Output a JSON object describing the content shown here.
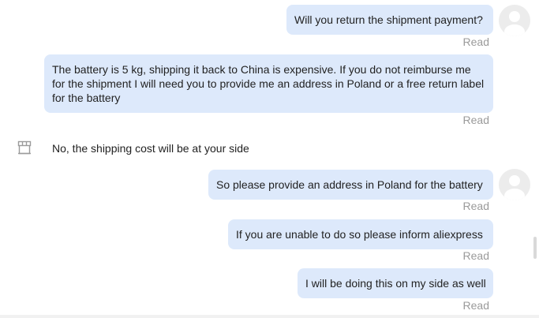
{
  "messages": [
    {
      "text": "Will you return the shipment payment?",
      "status": "Read"
    },
    {
      "text": "The battery is 5 kg, shipping it back to China is expensive. If you do not reimburse me for the shipment I will need you to provide me an address in Poland or a free return label for the battery",
      "status": "Read"
    },
    {
      "text": "No, the shipping cost will be at your side"
    },
    {
      "text": "So please provide an address in Poland for the battery",
      "status": "Read"
    },
    {
      "text": "If you are unable to do so please inform aliexpress",
      "status": "Read"
    },
    {
      "text": "I will be doing this on my side as well",
      "status": "Read"
    }
  ],
  "colors": {
    "outgoing_bubble": "#dde9fb",
    "status_text": "#9a9a9a",
    "avatar_bg": "#ececec"
  },
  "icons": {
    "user_avatar": "user-avatar-icon",
    "shop": "shop-icon"
  }
}
